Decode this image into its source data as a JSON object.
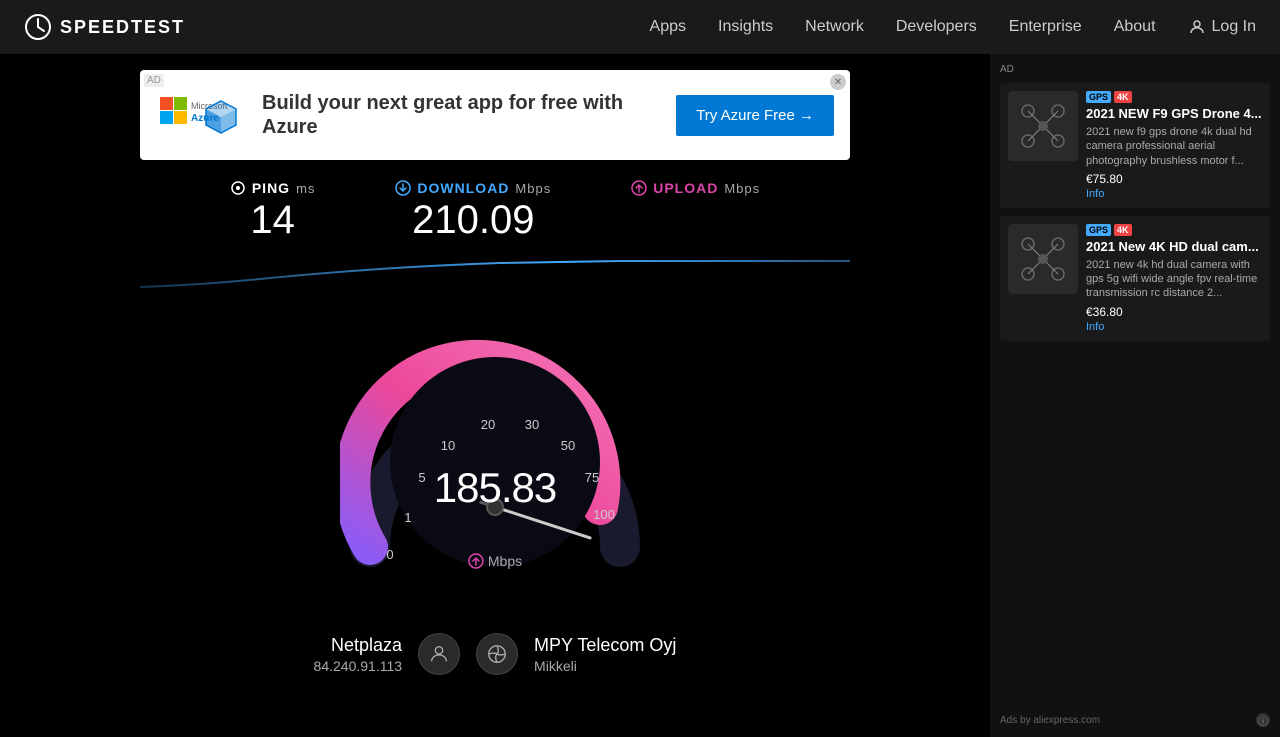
{
  "nav": {
    "logo_text": "SPEEDTEST",
    "links": [
      "Apps",
      "Insights",
      "Network",
      "Developers",
      "Enterprise",
      "About"
    ],
    "login_label": "Log In"
  },
  "ad_banner": {
    "label": "AD",
    "logo_brand": "Microsoft Azure",
    "text": "Build your next great app for free with Azure",
    "cta": "Try Azure Free →"
  },
  "stats": {
    "ping": {
      "label": "PING",
      "unit": "ms",
      "value": "14"
    },
    "download": {
      "label": "DOWNLOAD",
      "unit": "Mbps",
      "value": "210.09"
    },
    "upload": {
      "label": "UPLOAD",
      "unit": "Mbps",
      "value": ""
    }
  },
  "speedometer": {
    "current_value": "185.83",
    "unit": "Mbps",
    "labels": [
      "0",
      "1",
      "5",
      "10",
      "20",
      "30",
      "50",
      "75",
      "100"
    ],
    "needle_angle": 195
  },
  "isp": {
    "name": "Netplaza",
    "ip": "84.240.91.113",
    "provider": "MPY Telecom Oyj",
    "location": "Mikkeli"
  },
  "right_ads": {
    "label": "AD",
    "cards": [
      {
        "title": "2021 NEW F9 GPS Drone 4...",
        "desc": "2021 new f9 gps drone 4k dual hd camera professional aerial photography brushless motor f...",
        "price": "€75.80",
        "info": "Info",
        "gps_tag": "GPS",
        "k4_tag": "4K",
        "icon": "🚁"
      },
      {
        "title": "2021 New 4K HD dual cam...",
        "desc": "2021 new 4k hd dual camera with gps 5g wifi wide angle fpv real-time transmission rc distance 2...",
        "price": "€36.80",
        "info": "Info",
        "gps_tag": "GPS",
        "k4_tag": "4K",
        "icon": "🚁"
      }
    ],
    "footer_text": "Ads by aliexpress.com"
  }
}
